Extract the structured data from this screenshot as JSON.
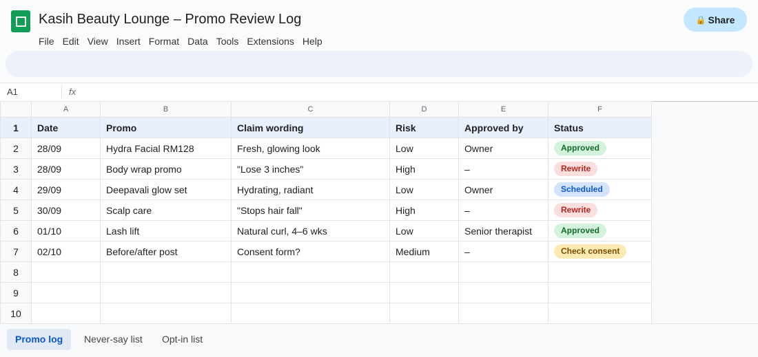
{
  "app": {
    "title": "Kasih Beauty Lounge – Promo Review Log",
    "menu": [
      "File",
      "Edit",
      "View",
      "Insert",
      "Format",
      "Data",
      "Tools",
      "Extensions",
      "Help"
    ],
    "share_label": "Share",
    "share_icon": "lock-icon",
    "brand_color": "#0f9d58"
  },
  "formula_bar": {
    "cell_ref": "A1",
    "fx_label": "fx",
    "formula": ""
  },
  "sheet": {
    "column_letters": [
      "A",
      "B",
      "C",
      "D",
      "E",
      "F"
    ],
    "row_numbers": [
      "1",
      "2",
      "3",
      "4",
      "5",
      "6",
      "7",
      "8",
      "9",
      "10"
    ],
    "header": [
      "Date",
      "Promo",
      "Claim wording",
      "Risk",
      "Approved by",
      "Status"
    ],
    "rows": [
      {
        "date": "28/09",
        "promo": "Hydra Facial RM128",
        "claim": "Fresh, glowing look",
        "risk": "Low",
        "approved_by": "Owner",
        "status": "Approved",
        "status_bg": "#d3f3dc",
        "status_fg": "#146c2e"
      },
      {
        "date": "28/09",
        "promo": "Body wrap promo",
        "claim": "\"Lose 3 inches\"",
        "risk": "High",
        "approved_by": "–",
        "status": "Rewrite",
        "status_bg": "#fbdede",
        "status_fg": "#b3261e"
      },
      {
        "date": "29/09",
        "promo": "Deepavali glow set",
        "claim": "Hydrating, radiant",
        "risk": "Low",
        "approved_by": "Owner",
        "status": "Scheduled",
        "status_bg": "#d3e3fd",
        "status_fg": "#0b57d0"
      },
      {
        "date": "30/09",
        "promo": "Scalp care",
        "claim": "\"Stops hair fall\"",
        "risk": "High",
        "approved_by": "–",
        "status": "Rewrite",
        "status_bg": "#fbdede",
        "status_fg": "#b3261e"
      },
      {
        "date": "01/10",
        "promo": "Lash lift",
        "claim": "Natural curl, 4–6 wks",
        "risk": "Low",
        "approved_by": "Senior therapist",
        "status": "Approved",
        "status_bg": "#d3f3dc",
        "status_fg": "#146c2e"
      },
      {
        "date": "02/10",
        "promo": "Before/after post",
        "claim": "Consent form?",
        "risk": "Medium",
        "approved_by": "–",
        "status": "Check consent",
        "status_bg": "#fde9b3",
        "status_fg": "#7a4b00"
      }
    ],
    "empty_rows": 3
  },
  "tabs": [
    {
      "label": "Promo log",
      "active": true
    },
    {
      "label": "Never-say list",
      "active": false
    },
    {
      "label": "Opt-in list",
      "active": false
    }
  ]
}
